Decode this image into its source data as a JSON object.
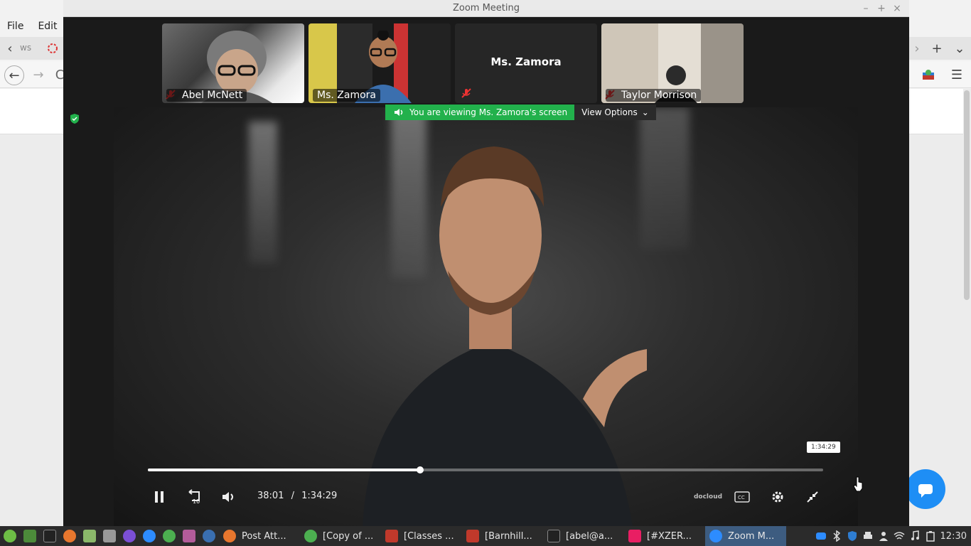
{
  "browser": {
    "menu": [
      "File",
      "Edit"
    ],
    "tab_text": "ws"
  },
  "zoom": {
    "window_title": "Zoom Meeting",
    "participants": [
      {
        "name": "Abel McNett",
        "muted": true
      },
      {
        "name": "Ms. Zamora",
        "muted": false
      },
      {
        "name": "Ms. Zamora",
        "muted": true,
        "video_off": true
      },
      {
        "name": "Taylor Morrison",
        "muted": true
      }
    ],
    "share_banner": "You are viewing Ms. Zamora's screen",
    "view_options": "View Options"
  },
  "video": {
    "current_time": "38:01",
    "separator": "/",
    "duration": "1:34:29",
    "tooltip_time": "1:34:29",
    "progress": 0.403,
    "brand": "docloud"
  },
  "taskbar": {
    "tasks": [
      {
        "label": "Post Att...",
        "color": "#e8772e"
      },
      {
        "label": "[Copy of ...",
        "color": "#4caf50"
      },
      {
        "label": "[Classes ...",
        "color": "#c0392b"
      },
      {
        "label": "[Barnhill...",
        "color": "#c0392b"
      },
      {
        "label": "[abel@a...",
        "color": "#333333"
      },
      {
        "label": "[#XZER...",
        "color": "#e91e63"
      },
      {
        "label": "Zoom M...",
        "color": "#2d8cff"
      }
    ],
    "clock": "12:30"
  },
  "colors": {
    "zoom_blue": "#2d8cff",
    "share_green": "#22b14c",
    "taskbar_bg": "#2b2b2b",
    "active_task": "#3d5c80"
  }
}
